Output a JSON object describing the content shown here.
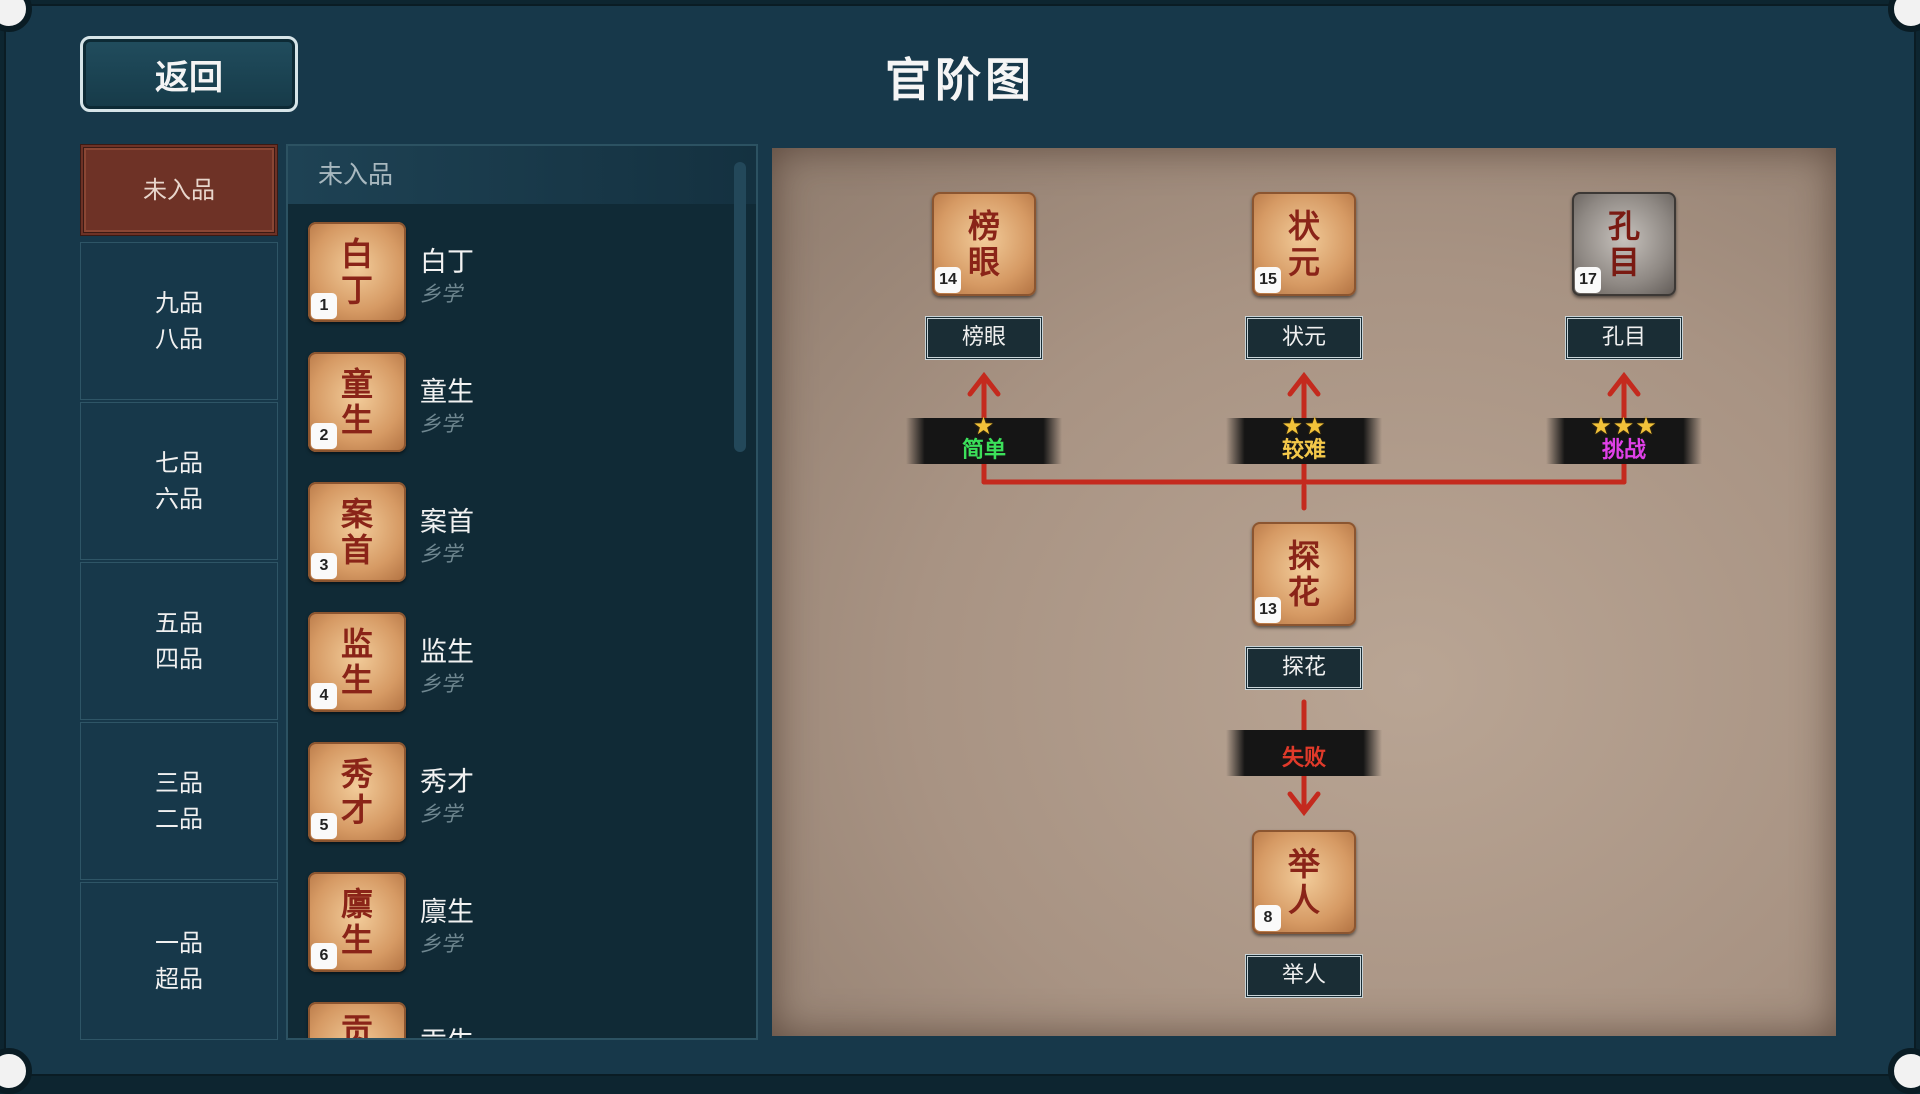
{
  "header": {
    "back_label": "返回",
    "title": "官阶图"
  },
  "ranks": [
    {
      "line1": "未入品",
      "line2": "",
      "active": true
    },
    {
      "line1": "九品",
      "line2": "八品",
      "active": false
    },
    {
      "line1": "七品",
      "line2": "六品",
      "active": false
    },
    {
      "line1": "五品",
      "line2": "四品",
      "active": false
    },
    {
      "line1": "三品",
      "line2": "二品",
      "active": false
    },
    {
      "line1": "一品",
      "line2": "超品",
      "active": false
    }
  ],
  "list": {
    "header": "未入品",
    "items": [
      {
        "glyph1": "白",
        "glyph2": "丁",
        "num": "1",
        "name": "白丁",
        "sub": "乡学"
      },
      {
        "glyph1": "童",
        "glyph2": "生",
        "num": "2",
        "name": "童生",
        "sub": "乡学"
      },
      {
        "glyph1": "案",
        "glyph2": "首",
        "num": "3",
        "name": "案首",
        "sub": "乡学"
      },
      {
        "glyph1": "监",
        "glyph2": "生",
        "num": "4",
        "name": "监生",
        "sub": "乡学"
      },
      {
        "glyph1": "秀",
        "glyph2": "才",
        "num": "5",
        "name": "秀才",
        "sub": "乡学"
      },
      {
        "glyph1": "廪",
        "glyph2": "生",
        "num": "6",
        "name": "廪生",
        "sub": "乡学"
      },
      {
        "glyph1": "贡",
        "glyph2": "",
        "num": "",
        "name": "贡生",
        "sub": ""
      }
    ]
  },
  "map": {
    "nodes": {
      "bangyan": {
        "glyph1": "榜",
        "glyph2": "眼",
        "num": "14",
        "name": "榜眼"
      },
      "zhuangyuan": {
        "glyph1": "状",
        "glyph2": "元",
        "num": "15",
        "name": "状元"
      },
      "kongmu": {
        "glyph1": "孔",
        "glyph2": "目",
        "num": "17",
        "name": "孔目"
      },
      "tanhua": {
        "glyph1": "探",
        "glyph2": "花",
        "num": "13",
        "name": "探花"
      },
      "juren": {
        "glyph1": "举",
        "glyph2": "人",
        "num": "8",
        "name": "举人"
      }
    },
    "badges": {
      "easy": {
        "stars": "★",
        "label": "简单",
        "color": "#3be05a"
      },
      "hard": {
        "stars": "★★",
        "label": "较难",
        "color": "#f4c84a"
      },
      "challenge": {
        "stars": "★★★",
        "label": "挑战",
        "color": "#e040e8"
      },
      "fail": {
        "label": "失败",
        "color": "#e03a2a"
      }
    },
    "arrow_color": "#c42a1e"
  }
}
